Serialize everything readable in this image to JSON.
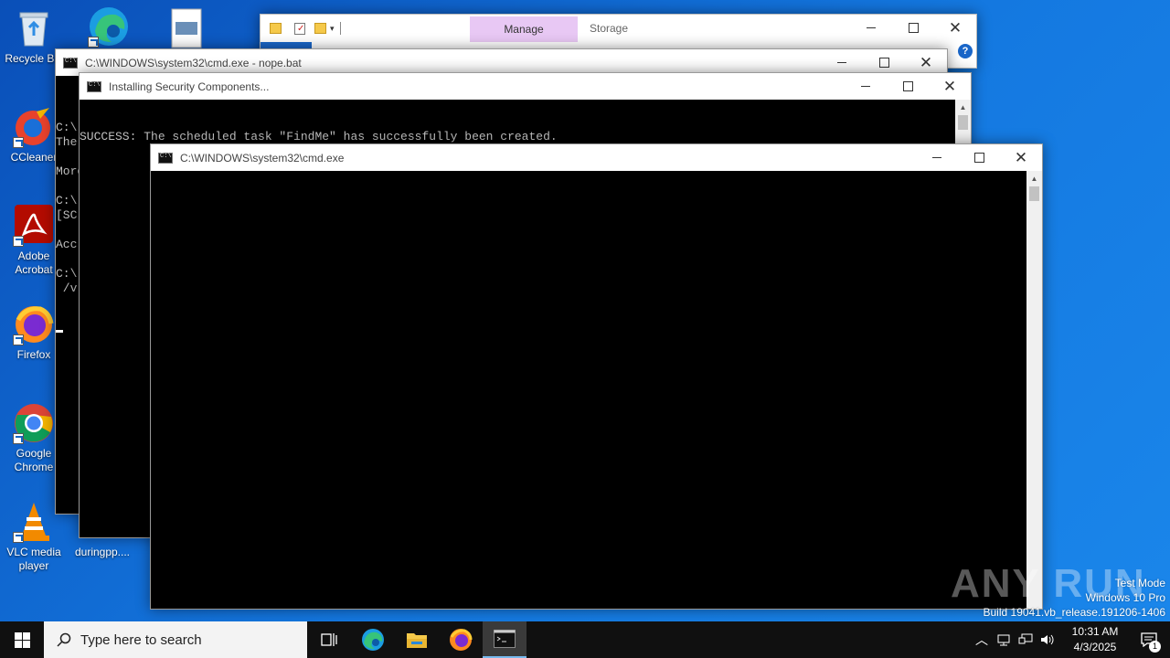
{
  "desktop": {
    "icons": [
      {
        "label": "Recycle Bin"
      },
      {
        "label": "CCleaner"
      },
      {
        "label": "Adobe Acrobat"
      },
      {
        "label": "Firefox"
      },
      {
        "label": "Google Chrome"
      },
      {
        "label": "VLC media player"
      },
      {
        "label": "duringpp...."
      }
    ]
  },
  "explorer": {
    "ribbon_manage": "Manage",
    "ribbon_storage": "Storage"
  },
  "cmd_nope": {
    "title": "C:\\WINDOWS\\system32\\cmd.exe - nope.bat",
    "lines": [
      "C:\\",
      "The",
      "",
      "More",
      "",
      "C:\\",
      "[SC",
      "",
      "Acc",
      "",
      "C:\\",
      " /v"
    ]
  },
  "cmd_installing": {
    "title": "Installing Security Components...",
    "output": "SUCCESS: The scheduled task \"FindMe\" has successfully been created."
  },
  "cmd_main": {
    "title": "C:\\WINDOWS\\system32\\cmd.exe"
  },
  "watermark": {
    "brand": "ANY RUN",
    "line1": "Test Mode",
    "line2": "Windows 10 Pro",
    "line3": "Build 19041.vb_release.191206-1406"
  },
  "taskbar": {
    "search_placeholder": "Type here to search",
    "time": "10:31 AM",
    "date": "4/3/2025",
    "notification_count": "1"
  },
  "colors": {
    "desktop_blue": "#1478e0",
    "taskbar": "#101010",
    "console_bg": "#000000",
    "ribbon_manage": "#e8c8f4"
  }
}
